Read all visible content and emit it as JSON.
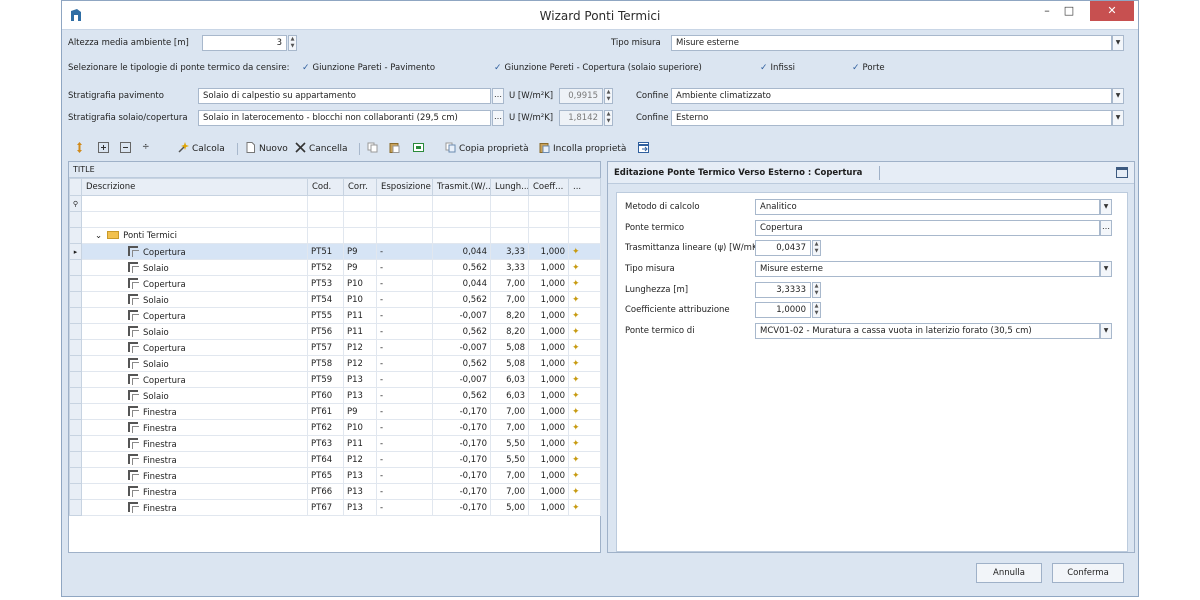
{
  "window": {
    "title": "Wizard Ponti Termici",
    "minimize": "–",
    "maximize": "□",
    "close": "✕"
  },
  "form": {
    "altezza_label": "Altezza media ambiente [m]",
    "altezza_value": "3",
    "tipo_misura_label": "Tipo misura",
    "tipo_misura_value": "Misure esterne",
    "tipologie_label": "Selezionare le tipologie di ponte termico da censire:",
    "check_giunzione_pavimento": "Giunzione Pareti - Pavimento",
    "check_giunzione_copertura": "Giunzione Pereti - Copertura (solaio superiore)",
    "check_infissi": "Infissi",
    "check_porte": "Porte",
    "strat_pavimento_label": "Stratigrafia pavimento",
    "strat_pavimento_value": "Solaio di calpestio su appartamento",
    "strat_copertura_label": "Stratigrafia solaio/copertura",
    "strat_copertura_value": "Solaio in laterocemento - blocchi non collaboranti (29,5 cm)",
    "u_label": "U [W/m²K]",
    "u_pavimento": "0,9915",
    "u_copertura": "1,8142",
    "confine_label": "Confine",
    "confine_pavimento": "Ambiente climatizzato",
    "confine_copertura": "Esterno"
  },
  "toolbar": {
    "calcola": "Calcola",
    "nuovo": "Nuovo",
    "cancella": "Cancella",
    "copia": "Copia proprietà",
    "incolla": "Incolla proprietà"
  },
  "grid": {
    "caption": "TITLE",
    "columns": [
      "Descrizione",
      "Cod.",
      "Corr.",
      "Esposizione",
      "Trasmit.(W/...",
      "Lungh...",
      "Coeff...",
      "..."
    ],
    "group": "Ponti Termici",
    "rows": [
      {
        "desc": "Copertura",
        "cod": "PT51",
        "corr": "P9",
        "esp": "-",
        "trasm": "0,044",
        "lungh": "3,33",
        "coeff": "1,000"
      },
      {
        "desc": "Solaio",
        "cod": "PT52",
        "corr": "P9",
        "esp": "-",
        "trasm": "0,562",
        "lungh": "3,33",
        "coeff": "1,000"
      },
      {
        "desc": "Copertura",
        "cod": "PT53",
        "corr": "P10",
        "esp": "-",
        "trasm": "0,044",
        "lungh": "7,00",
        "coeff": "1,000"
      },
      {
        "desc": "Solaio",
        "cod": "PT54",
        "corr": "P10",
        "esp": "-",
        "trasm": "0,562",
        "lungh": "7,00",
        "coeff": "1,000"
      },
      {
        "desc": "Copertura",
        "cod": "PT55",
        "corr": "P11",
        "esp": "-",
        "trasm": "-0,007",
        "lungh": "8,20",
        "coeff": "1,000"
      },
      {
        "desc": "Solaio",
        "cod": "PT56",
        "corr": "P11",
        "esp": "-",
        "trasm": "0,562",
        "lungh": "8,20",
        "coeff": "1,000"
      },
      {
        "desc": "Copertura",
        "cod": "PT57",
        "corr": "P12",
        "esp": "-",
        "trasm": "-0,007",
        "lungh": "5,08",
        "coeff": "1,000"
      },
      {
        "desc": "Solaio",
        "cod": "PT58",
        "corr": "P12",
        "esp": "-",
        "trasm": "0,562",
        "lungh": "5,08",
        "coeff": "1,000"
      },
      {
        "desc": "Copertura",
        "cod": "PT59",
        "corr": "P13",
        "esp": "-",
        "trasm": "-0,007",
        "lungh": "6,03",
        "coeff": "1,000"
      },
      {
        "desc": "Solaio",
        "cod": "PT60",
        "corr": "P13",
        "esp": "-",
        "trasm": "0,562",
        "lungh": "6,03",
        "coeff": "1,000"
      },
      {
        "desc": "Finestra",
        "cod": "PT61",
        "corr": "P9",
        "esp": "-",
        "trasm": "-0,170",
        "lungh": "7,00",
        "coeff": "1,000"
      },
      {
        "desc": "Finestra",
        "cod": "PT62",
        "corr": "P10",
        "esp": "-",
        "trasm": "-0,170",
        "lungh": "7,00",
        "coeff": "1,000"
      },
      {
        "desc": "Finestra",
        "cod": "PT63",
        "corr": "P11",
        "esp": "-",
        "trasm": "-0,170",
        "lungh": "5,50",
        "coeff": "1,000"
      },
      {
        "desc": "Finestra",
        "cod": "PT64",
        "corr": "P12",
        "esp": "-",
        "trasm": "-0,170",
        "lungh": "5,50",
        "coeff": "1,000"
      },
      {
        "desc": "Finestra",
        "cod": "PT65",
        "corr": "P13",
        "esp": "-",
        "trasm": "-0,170",
        "lungh": "7,00",
        "coeff": "1,000"
      },
      {
        "desc": "Finestra",
        "cod": "PT66",
        "corr": "P13",
        "esp": "-",
        "trasm": "-0,170",
        "lungh": "7,00",
        "coeff": "1,000"
      },
      {
        "desc": "Finestra",
        "cod": "PT67",
        "corr": "P13",
        "esp": "-",
        "trasm": "-0,170",
        "lungh": "5,00",
        "coeff": "1,000"
      }
    ]
  },
  "panel": {
    "title": "Editazione Ponte Termico Verso Esterno : Copertura",
    "metodo_label": "Metodo di calcolo",
    "metodo_value": "Analitico",
    "ponte_label": "Ponte termico",
    "ponte_value": "Copertura",
    "trasm_label": "Trasmittanza lineare (ψ) [W/mK]",
    "trasm_value": "0,0437",
    "tipo_label": "Tipo misura",
    "tipo_value": "Misure esterne",
    "lungh_label": "Lunghezza [m]",
    "lungh_value": "3,3333",
    "coeff_label": "Coefficiente attribuzione",
    "coeff_value": "1,0000",
    "ponte_di_label": "Ponte termico di",
    "ponte_di_value": "MCV01-02 - Muratura a cassa vuota in laterizio forato (30,5 cm)"
  },
  "footer": {
    "annulla": "Annulla",
    "conferma": "Conferma"
  }
}
